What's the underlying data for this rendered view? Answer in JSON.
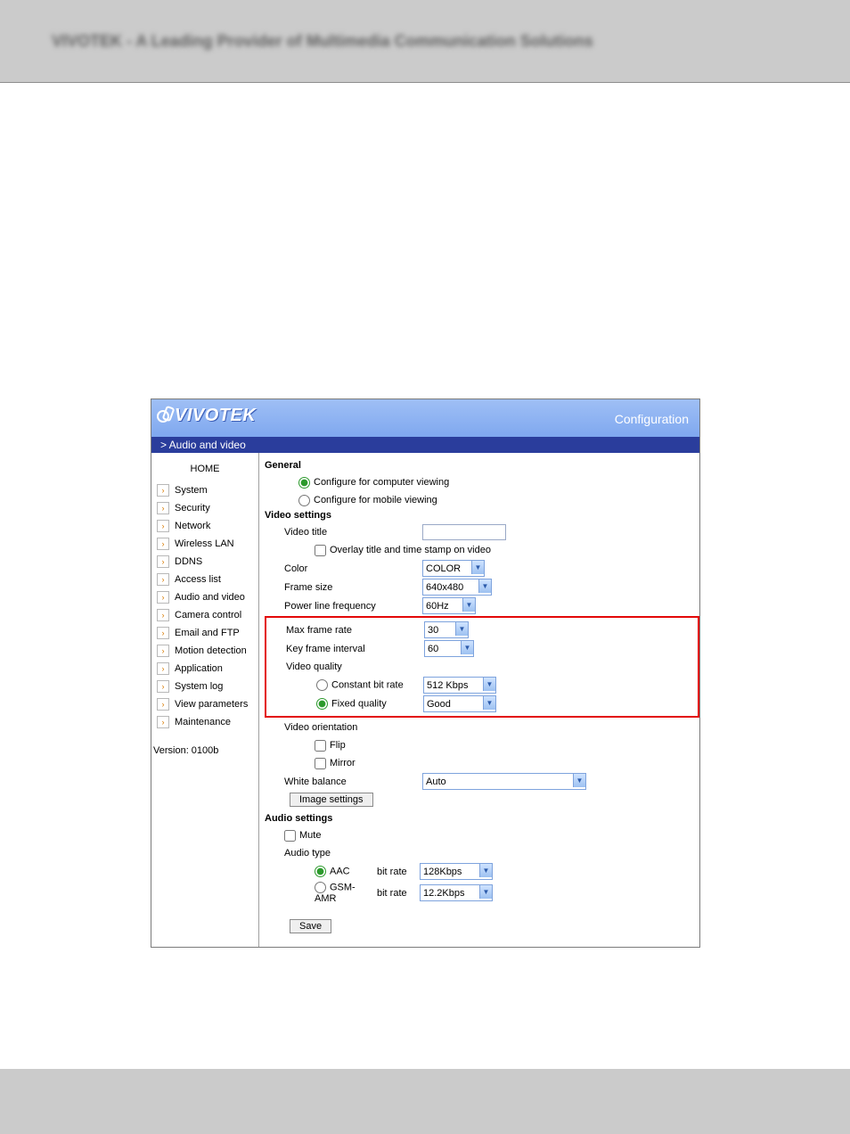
{
  "doc_header": "VIVOTEK - A Leading Provider of Multimedia Communication Solutions",
  "brand": "VIVOTEK",
  "header_right": "Configuration",
  "breadcrumb": "> Audio and video",
  "sidebar": {
    "home": "HOME",
    "items": [
      {
        "label": "System"
      },
      {
        "label": "Security"
      },
      {
        "label": "Network"
      },
      {
        "label": "Wireless LAN"
      },
      {
        "label": "DDNS"
      },
      {
        "label": "Access list"
      },
      {
        "label": "Audio and video"
      },
      {
        "label": "Camera control"
      },
      {
        "label": "Email and FTP"
      },
      {
        "label": "Motion detection"
      },
      {
        "label": "Application"
      },
      {
        "label": "System log"
      },
      {
        "label": "View parameters"
      },
      {
        "label": "Maintenance"
      }
    ],
    "version_label": "Version: 0100b"
  },
  "sections": {
    "general": {
      "title": "General",
      "computer_view": "Configure for computer viewing",
      "mobile_view": "Configure for mobile viewing",
      "selected": "computer"
    },
    "video": {
      "title": "Video settings",
      "video_title_label": "Video title",
      "video_title_value": "",
      "overlay_label": "Overlay title and time stamp on video",
      "overlay_checked": false,
      "color_label": "Color",
      "color_value": "COLOR",
      "frame_size_label": "Frame size",
      "frame_size_value": "640x480",
      "plf_label": "Power line frequency",
      "plf_value": "60Hz",
      "max_fr_label": "Max frame rate",
      "max_fr_value": "30",
      "kfi_label": "Key frame interval",
      "kfi_value": "60",
      "vq_label": "Video quality",
      "cbr_label": "Constant bit rate",
      "cbr_value": "512 Kbps",
      "fixed_label": "Fixed quality",
      "fixed_value": "Good",
      "vq_selected": "fixed",
      "orientation_label": "Video orientation",
      "flip_label": "Flip",
      "flip_checked": false,
      "mirror_label": "Mirror",
      "mirror_checked": false,
      "wb_label": "White balance",
      "wb_value": "Auto",
      "img_settings_btn": "Image settings"
    },
    "audio": {
      "title": "Audio settings",
      "mute_label": "Mute",
      "mute_checked": false,
      "type_label": "Audio type",
      "aac_label": "AAC",
      "gsm_label": "GSM-AMR",
      "bit_rate_label": "bit rate",
      "aac_value": "128Kbps",
      "gsm_value": "12.2Kbps",
      "selected": "aac"
    },
    "save_btn": "Save"
  }
}
